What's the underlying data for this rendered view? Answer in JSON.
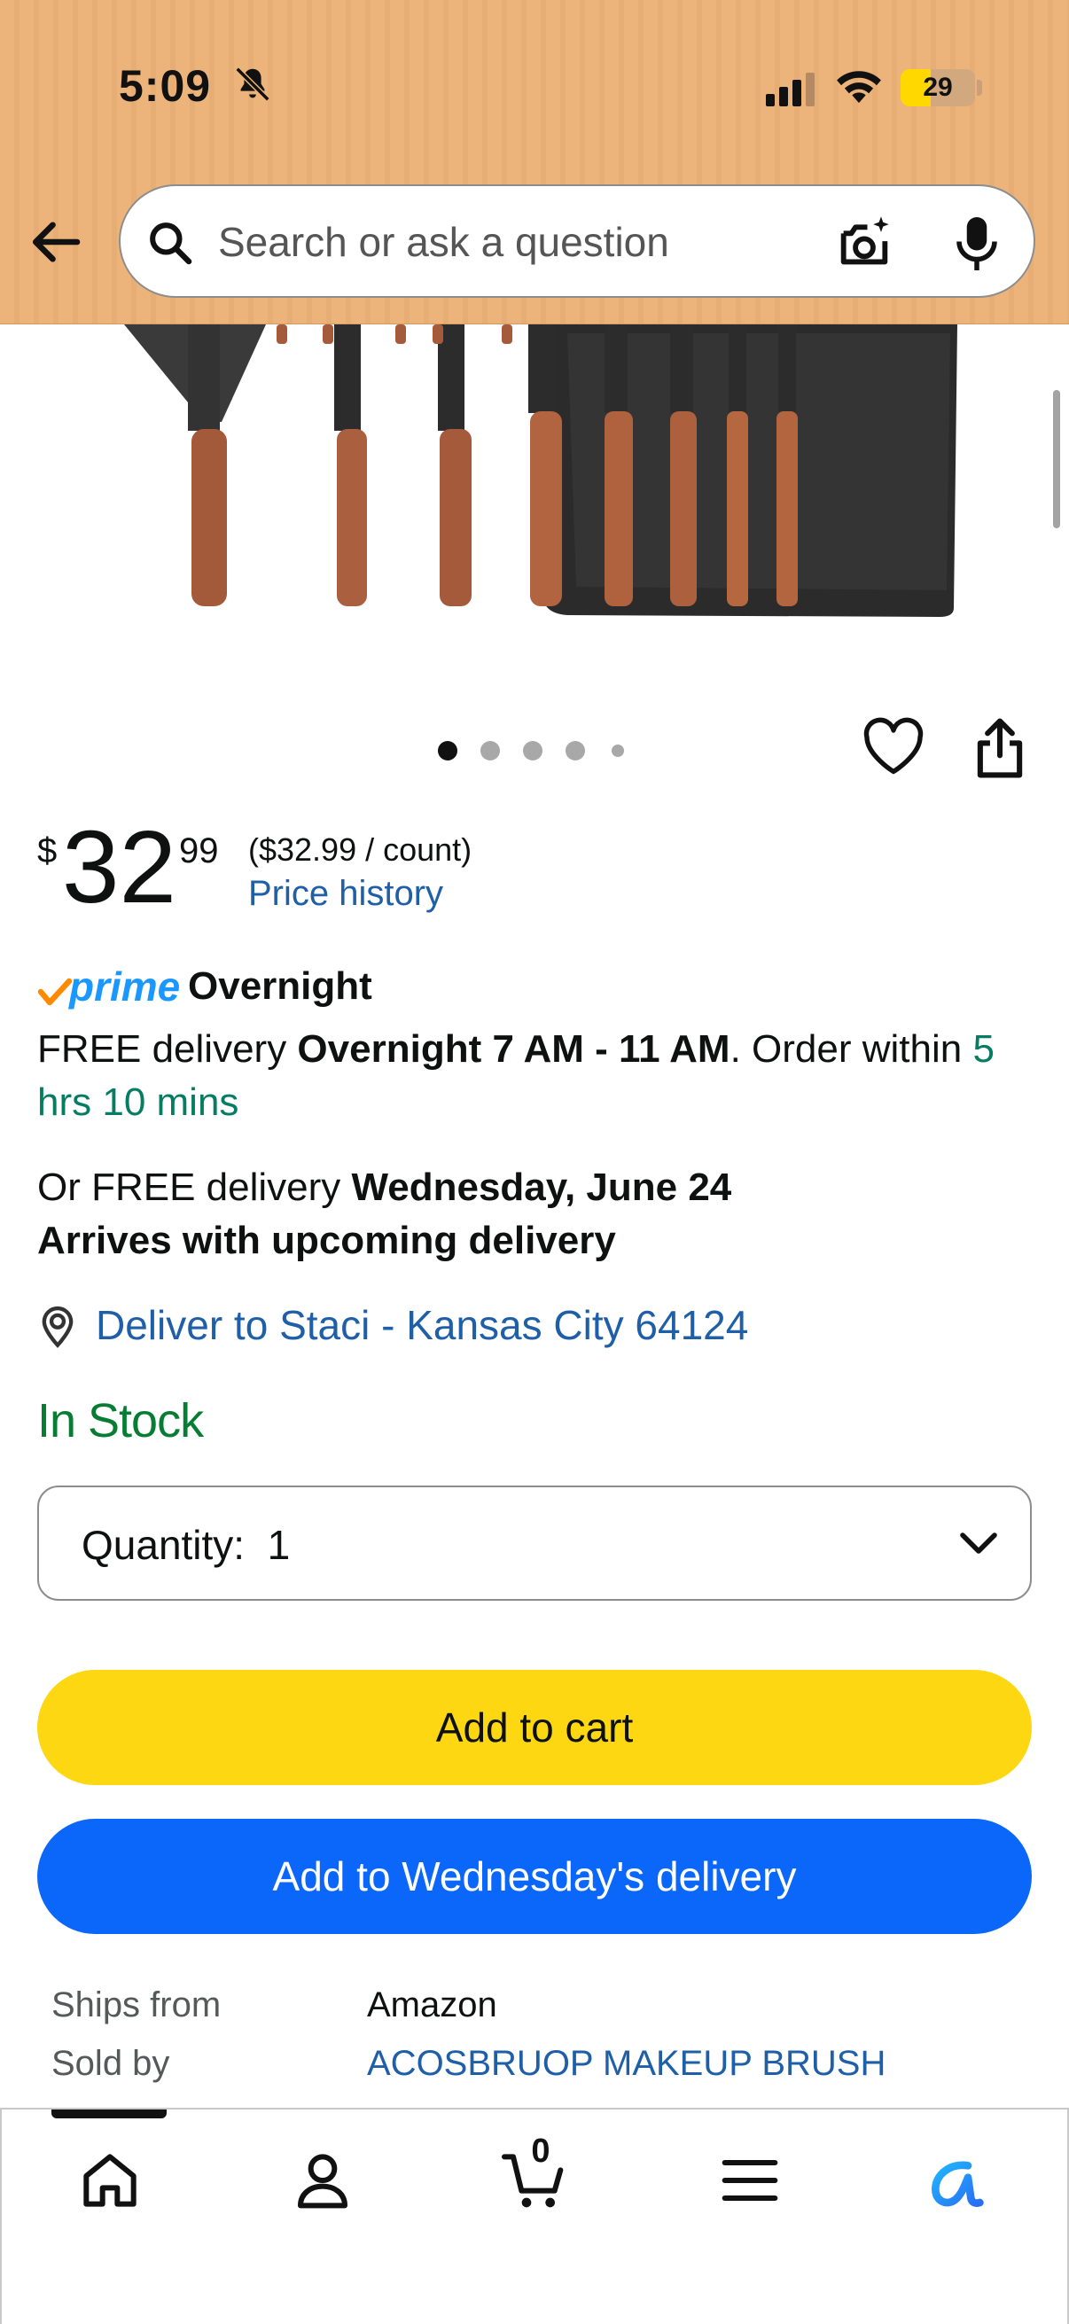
{
  "status_bar": {
    "time": "5:09",
    "battery": "29"
  },
  "search": {
    "placeholder": "Search or ask a question"
  },
  "gallery": {
    "dot_count": 5,
    "active_index": 0
  },
  "price": {
    "symbol": "$",
    "whole": "32",
    "fraction": "99",
    "unit": "($32.99 / count)",
    "history_link": "Price history"
  },
  "delivery": {
    "prime_label": "prime",
    "prime_speed": "Overnight",
    "line1_prefix": "FREE delivery ",
    "line1_bold": "Overnight 7 AM - 11 AM",
    "line1_suffix": ". Order within ",
    "countdown": "5 hrs 10 mins",
    "alt_prefix": "Or FREE delivery ",
    "alt_bold": "Wednesday, June 24",
    "alt_line2": "Arrives with upcoming delivery",
    "deliver_to": "Deliver to Staci - Kansas City 64124"
  },
  "stock": "In Stock",
  "quantity": {
    "label": "Quantity:",
    "value": "1"
  },
  "buttons": {
    "add_to_cart": "Add to cart",
    "add_to_delivery": "Add to Wednesday's delivery"
  },
  "seller": {
    "ships_from_label": "Ships from",
    "ships_from_value": "Amazon",
    "sold_by_label": "Sold by",
    "sold_by_value": "ACOSBRUOP MAKEUP BRUSH"
  },
  "bottom_nav": {
    "cart_count": "0",
    "items": [
      "home",
      "account",
      "cart",
      "menu",
      "rufus"
    ]
  },
  "colors": {
    "header": "#ecb47a",
    "add_to_cart": "#fcd712",
    "add_to_delivery": "#0b67f9",
    "link": "#1f5fa8",
    "in_stock": "#067d32"
  }
}
